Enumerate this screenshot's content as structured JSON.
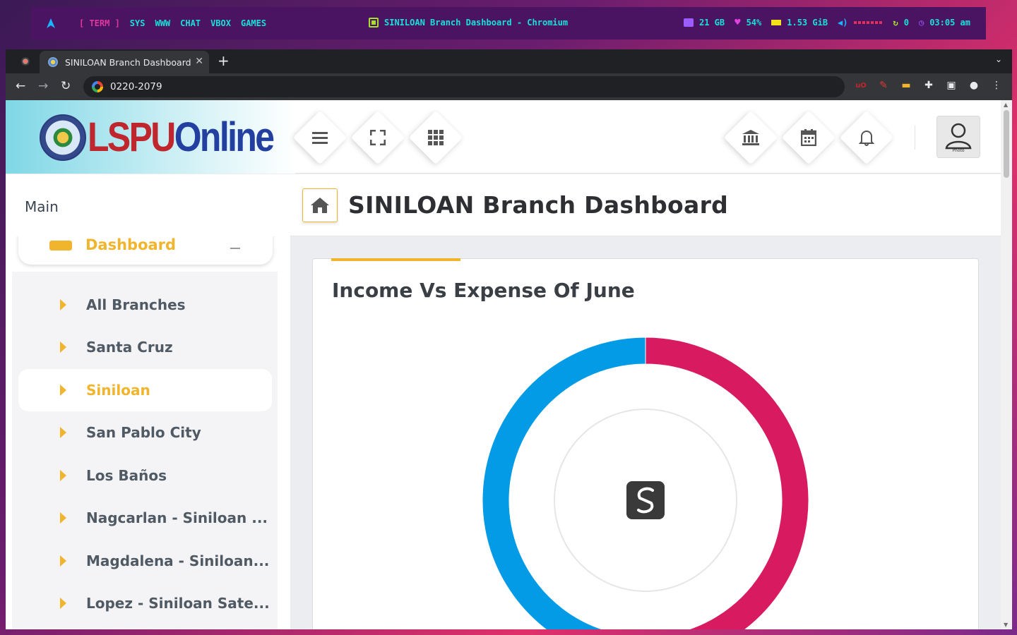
{
  "wm": {
    "workspaces": [
      "[ TERM ]",
      "SYS",
      "WWW",
      "CHAT",
      "VBOX",
      "GAMES"
    ],
    "window_title": "SINILOAN Branch Dashboard - Chromium",
    "disk": "21 GB",
    "cpu": "54%",
    "mem": "1.53 GiB",
    "updates": "0",
    "time": "03:05 am"
  },
  "browser": {
    "tab_title": "SINILOAN Branch Dashboard",
    "url": "0220-2079"
  },
  "site": {
    "logo_lspu": "LSPU",
    "logo_online": "Online",
    "avatar_label": "Photo",
    "section_label": "Main",
    "page_title": "SINILOAN Branch Dashboard",
    "dashboard_label": "Dashboard",
    "branches": [
      "All Branches",
      "Santa Cruz",
      "Siniloan",
      "San Pablo City",
      "Los Baños",
      "Nagcarlan - Siniloan ...",
      "Magdalena - Siniloan...",
      "Lopez - Siniloan Sate..."
    ],
    "active_branch_index": 2
  },
  "chart_data": {
    "type": "pie",
    "variant": "donut",
    "title": "Income Vs Expense Of June",
    "slices": [
      {
        "value": 55,
        "color": "#d81b60"
      },
      {
        "value": 45,
        "color": "#039be5"
      }
    ]
  },
  "colors": {
    "accent": "#f0b52c",
    "expense": "#d81b60",
    "income": "#039be5"
  }
}
